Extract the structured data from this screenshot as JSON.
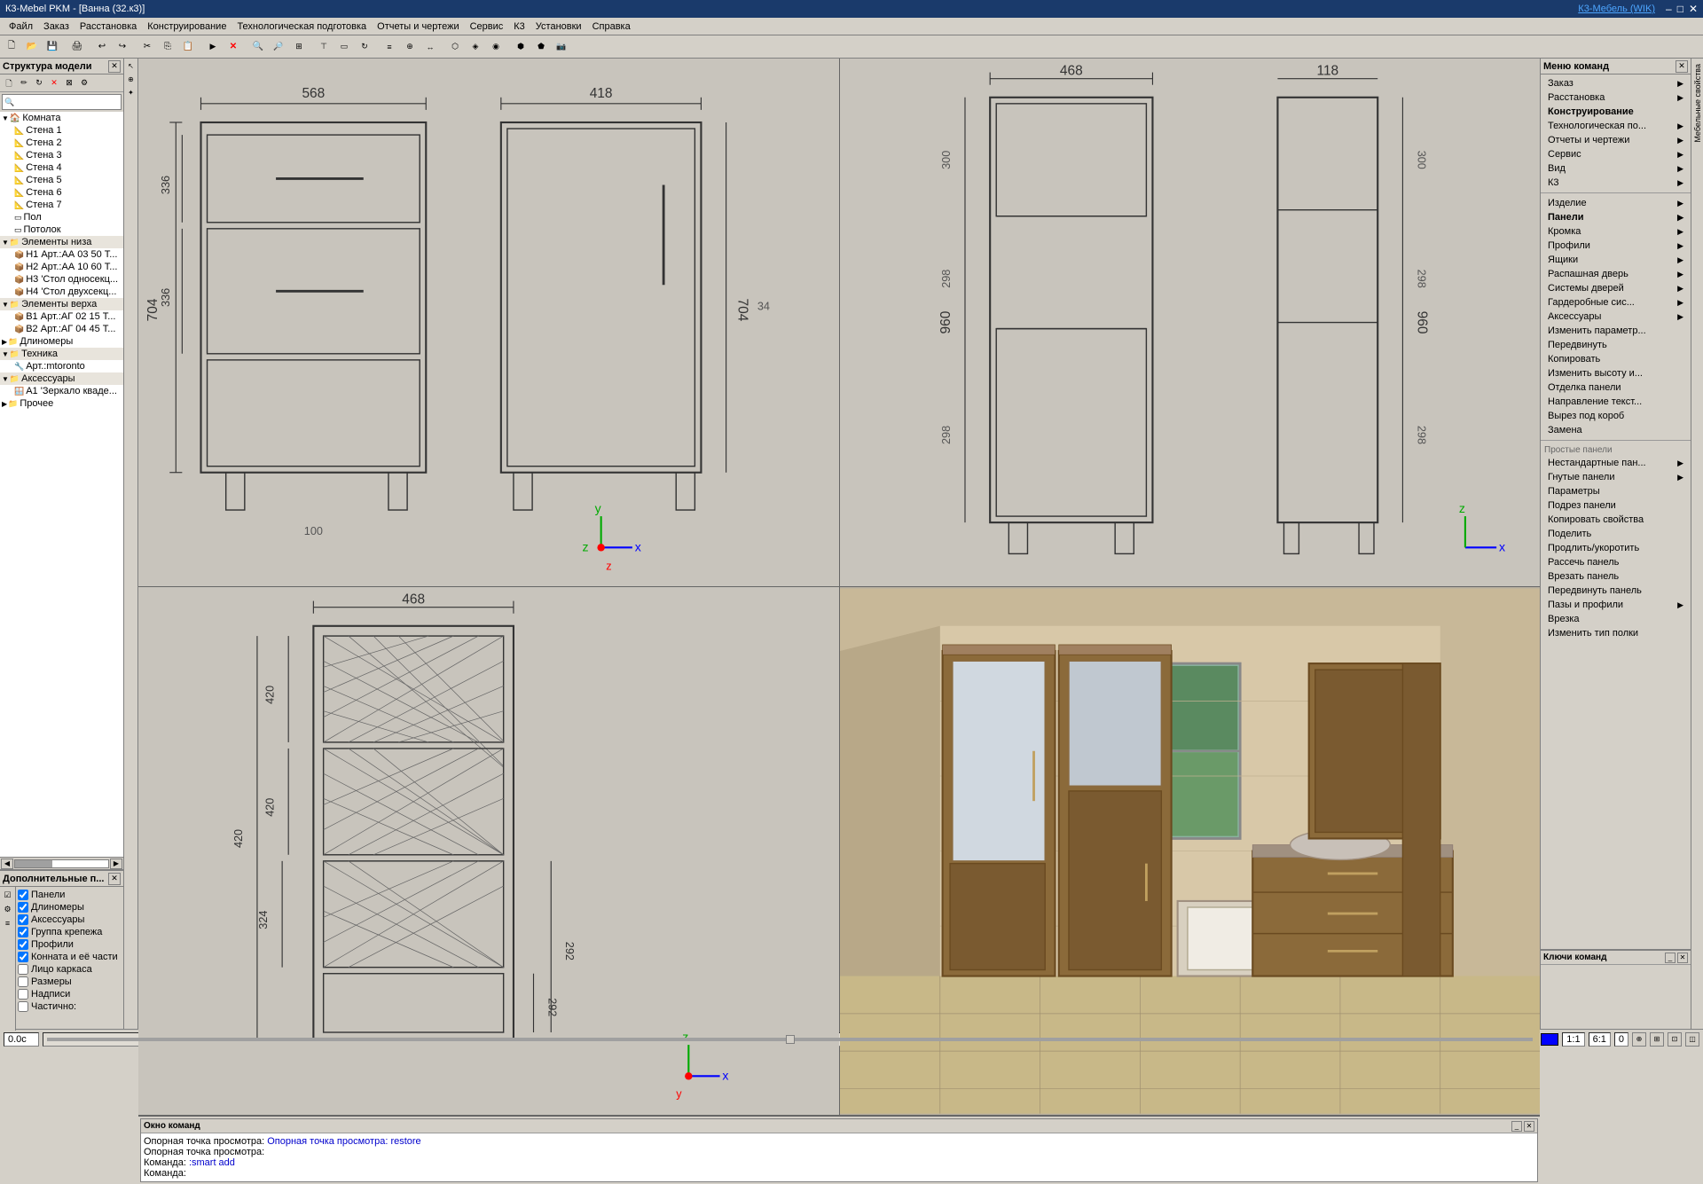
{
  "titlebar": {
    "title": "К3-Mebel PKM - [Ванна (32.к3)]",
    "k3link": "К3-Мебель (WIK)",
    "min": "–",
    "max": "□",
    "close": "✕"
  },
  "menubar": {
    "items": [
      "Файл",
      "Заказ",
      "Расстановка",
      "Конструирование",
      "Технологическая подготовка",
      "Отчеты и чертежи",
      "Сервис",
      "К3",
      "Установки",
      "Справка"
    ]
  },
  "structure_tree": {
    "title": "Структура модели",
    "items": [
      {
        "level": 0,
        "label": "Комната",
        "icon": "folder",
        "expanded": true
      },
      {
        "level": 1,
        "label": "Стена 1",
        "icon": "wall"
      },
      {
        "level": 1,
        "label": "Стена 2",
        "icon": "wall"
      },
      {
        "level": 1,
        "label": "Стена 3",
        "icon": "wall"
      },
      {
        "level": 1,
        "label": "Стена 4",
        "icon": "wall"
      },
      {
        "level": 1,
        "label": "Стена 5",
        "icon": "wall"
      },
      {
        "level": 1,
        "label": "Стена 6",
        "icon": "wall"
      },
      {
        "level": 1,
        "label": "Стена 7",
        "icon": "wall"
      },
      {
        "level": 1,
        "label": "Пол",
        "icon": "floor"
      },
      {
        "level": 1,
        "label": "Потолок",
        "icon": "ceiling"
      },
      {
        "level": 0,
        "label": "Элементы низа",
        "icon": "folder",
        "expanded": true
      },
      {
        "level": 1,
        "label": "Н1 Арт.:АА 03 50 Т...",
        "icon": "item"
      },
      {
        "level": 1,
        "label": "Н2 Арт.:АА 10 60 Т...",
        "icon": "item"
      },
      {
        "level": 1,
        "label": "Н3 'Стол односекц...",
        "icon": "item"
      },
      {
        "level": 1,
        "label": "Н4 'Стол двухсекц...",
        "icon": "item"
      },
      {
        "level": 0,
        "label": "Элементы верха",
        "icon": "folder",
        "expanded": true
      },
      {
        "level": 1,
        "label": "В1 Арт.:АГ 02 15 Т...",
        "icon": "item"
      },
      {
        "level": 1,
        "label": "В2 Арт.:АГ 04 45 Т...",
        "icon": "item"
      },
      {
        "level": 0,
        "label": "Длиномеры",
        "icon": "folder"
      },
      {
        "level": 0,
        "label": "Техника",
        "icon": "folder",
        "expanded": true
      },
      {
        "level": 1,
        "label": "Арт.:mtoronto",
        "icon": "item"
      },
      {
        "level": 0,
        "label": "Аксессуары",
        "icon": "folder",
        "expanded": true
      },
      {
        "level": 1,
        "label": "А1 'Зеркало кваде...",
        "icon": "item"
      },
      {
        "level": 0,
        "label": "Прочее",
        "icon": "folder"
      }
    ]
  },
  "additional_panels": {
    "title": "Дополнительные п...",
    "checkboxes": [
      {
        "label": "Панели",
        "checked": true
      },
      {
        "label": "Длиномеры",
        "checked": true
      },
      {
        "label": "Аксессуары",
        "checked": true
      },
      {
        "label": "Группа крепежа",
        "checked": true
      },
      {
        "label": "Профили",
        "checked": true
      },
      {
        "label": "Конната и её части",
        "checked": true
      },
      {
        "label": "Лицо каркаса",
        "checked": false
      },
      {
        "label": "Размеры",
        "checked": false
      },
      {
        "label": "Надписи",
        "checked": false
      },
      {
        "label": "Частично:",
        "checked": false
      }
    ]
  },
  "command_window": {
    "title": "Окно команд",
    "lines": [
      "Опорная точка просмотра: restore",
      "Опорная точка просмотра: ",
      "Команда: :smart add",
      "Команда:"
    ]
  },
  "keys_panel": {
    "title": "Ключи команд"
  },
  "right_menu": {
    "title": "Меню команд",
    "items": [
      {
        "label": "Заказ",
        "has_arrow": true
      },
      {
        "label": "Расстановка",
        "has_arrow": true
      },
      {
        "label": "Конструирование",
        "has_arrow": false,
        "bold": true
      },
      {
        "label": "Технологическая по...",
        "has_arrow": true
      },
      {
        "label": "Отчеты и чертежи",
        "has_arrow": true
      },
      {
        "label": "Сервис",
        "has_arrow": true
      },
      {
        "label": "Вид",
        "has_arrow": true
      },
      {
        "label": "К3",
        "has_arrow": true
      },
      {
        "label": "",
        "separator": true
      },
      {
        "label": "Изделие",
        "has_arrow": true
      },
      {
        "label": "Панели",
        "has_arrow": true,
        "bold": true
      },
      {
        "label": "Кромка",
        "has_arrow": true
      },
      {
        "label": "Профили",
        "has_arrow": true
      },
      {
        "label": "Ящики",
        "has_arrow": true
      },
      {
        "label": "Распашная дверь",
        "has_arrow": true
      },
      {
        "label": "Системы дверей",
        "has_arrow": true
      },
      {
        "label": "Гардеробные сис...",
        "has_arrow": true
      },
      {
        "label": "Аксессуары",
        "has_arrow": true
      },
      {
        "label": "Изменить параметр...",
        "has_arrow": false
      },
      {
        "label": "Передвинуть",
        "has_arrow": false
      },
      {
        "label": "Копировать",
        "has_arrow": false
      },
      {
        "label": "Изменить высоту и...",
        "has_arrow": false
      },
      {
        "label": "Отделка панели",
        "has_arrow": false
      },
      {
        "label": "Направление текст...",
        "has_arrow": false
      },
      {
        "label": "Вырез под короб",
        "has_arrow": false
      },
      {
        "label": "Замена",
        "has_arrow": false
      },
      {
        "label": "",
        "separator": true
      },
      {
        "label": "Простые панели",
        "section": true
      },
      {
        "label": "Нестандартные пан...",
        "has_arrow": true
      },
      {
        "label": "Гнутые панели",
        "has_arrow": true
      },
      {
        "label": "Параметры",
        "has_arrow": false
      },
      {
        "label": "Подрез панели",
        "has_arrow": false
      },
      {
        "label": "Копировать свойства",
        "has_arrow": false
      },
      {
        "label": "Поделить",
        "has_arrow": false
      },
      {
        "label": "Продлить/укоротить",
        "has_arrow": false
      },
      {
        "label": "Рассечь панель",
        "has_arrow": false
      },
      {
        "label": "Врезать панель",
        "has_arrow": false
      },
      {
        "label": "Передвинуть панель",
        "has_arrow": false
      },
      {
        "label": "Пазы и профили",
        "has_arrow": true
      },
      {
        "label": "Врезка",
        "has_arrow": false
      },
      {
        "label": "Изменить тип полки",
        "has_arrow": false
      }
    ]
  },
  "statusbar": {
    "coords": "0.0с",
    "scale1": "1:1",
    "scale2": "6:1",
    "value": "0"
  },
  "viewport_dims": {
    "tl": {
      "w1": "568",
      "w2": "418",
      "h1": "704",
      "h2": "336",
      "h3": "336",
      "h4": "100",
      "label": "34"
    },
    "tr": {
      "w1": "468",
      "w2": "118",
      "h1": "960",
      "h2": "298",
      "h3": "298",
      "h4": "300"
    },
    "bl": {
      "w1": "468",
      "h1": "420",
      "h2": "420",
      "h3": "324",
      "h4": "420",
      "h5": "292",
      "h6": "292"
    },
    "br": {}
  },
  "toolbar_icons": [
    "new",
    "open",
    "save",
    "print",
    "sep",
    "undo",
    "redo",
    "sep",
    "cut",
    "copy",
    "paste",
    "delete",
    "sep",
    "select",
    "move",
    "rotate",
    "sep",
    "zoom-in",
    "zoom-out",
    "zoom-all",
    "sep",
    "view-top",
    "view-front",
    "view-3d"
  ]
}
